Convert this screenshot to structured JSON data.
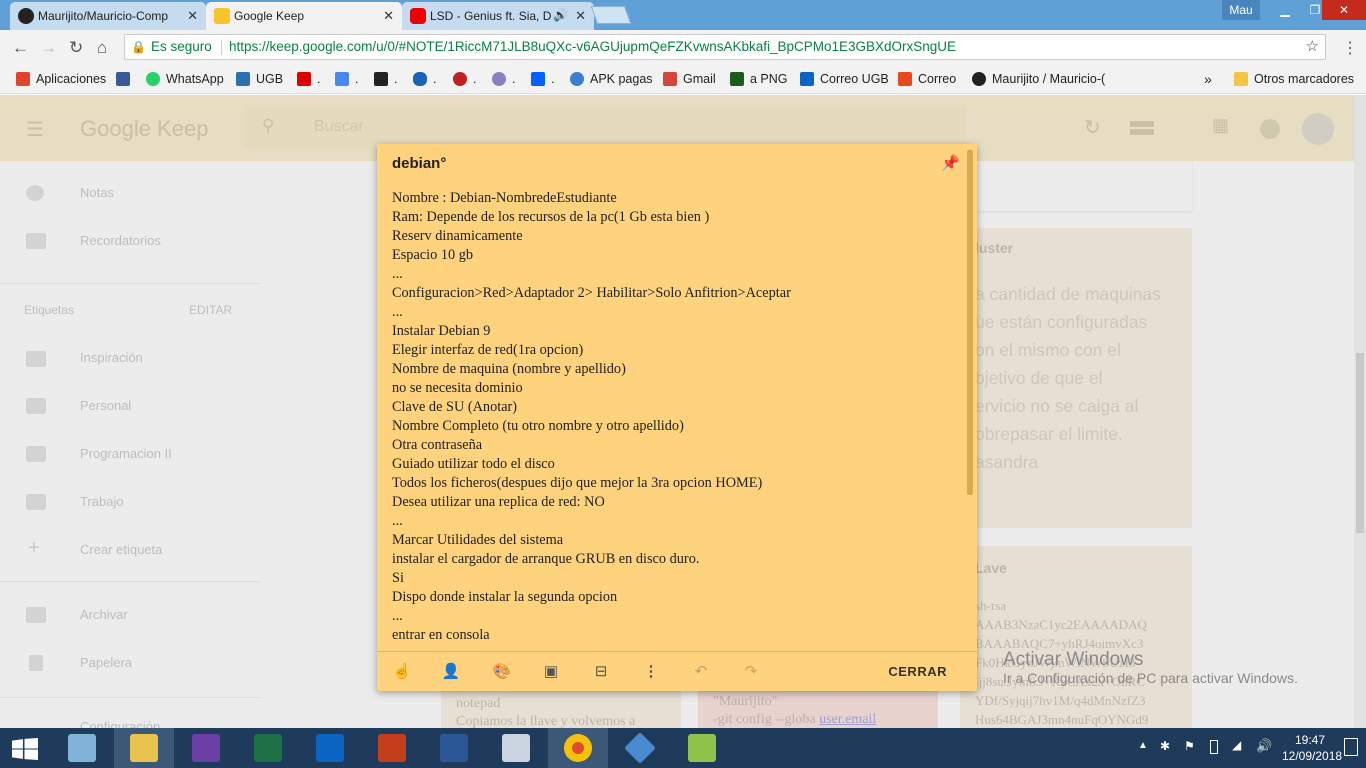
{
  "browser": {
    "tabs": [
      {
        "label": "Maurijito/Mauricio-Comp",
        "close": "✕"
      },
      {
        "label": "Google Keep",
        "close": "✕"
      },
      {
        "label": "LSD - Genius ft. Sia, D",
        "close": "✕"
      }
    ],
    "user": "Mau",
    "secure_label": "Es seguro",
    "url": "https://keep.google.com/u/0/#NOTE/1RiccM71JLB8uQXc-v6AGUjupmQeFZKvwnsAKbkafi_BpCPMo1E3GBXdOrxSngUE",
    "bookmarks": [
      {
        "label": "Aplicaciones",
        "icon": "apps-grid-icon",
        "color": "#e0452b"
      },
      {
        "label": "",
        "icon": "facebook-icon",
        "color": "#3b5998"
      },
      {
        "label": "WhatsApp",
        "icon": "whatsapp-icon",
        "color": "#25d366"
      },
      {
        "label": "UGB",
        "icon": "ugb-icon",
        "color": "#2c6fb3"
      },
      {
        "label": ".",
        "icon": "youtube-icon",
        "color": "#e00000"
      },
      {
        "label": ".",
        "icon": "translate-icon",
        "color": "#4a87f0"
      },
      {
        "label": ".",
        "icon": "x-icon",
        "color": "#222222"
      },
      {
        "label": ".",
        "icon": "cloud-icon",
        "color": "#1a62b8"
      },
      {
        "label": ".",
        "icon": "pokeball-icon",
        "color": "#c22020"
      },
      {
        "label": ".",
        "icon": "chrome-icon",
        "color": "#8c7fbf"
      },
      {
        "label": ".",
        "icon": "dropbox-icon",
        "color": "#0061fe"
      },
      {
        "label": "APK pagas",
        "icon": "apk-icon",
        "color": "#3a7fd0"
      },
      {
        "label": "Gmail",
        "icon": "gmail-icon",
        "color": "#d44638"
      },
      {
        "label": "a PNG",
        "icon": "png-icon",
        "color": "#1d5b1d"
      },
      {
        "label": "Correo UGB",
        "icon": "outlook-icon",
        "color": "#0a64c2"
      },
      {
        "label": "Correo",
        "icon": "office-icon",
        "color": "#e8491d"
      },
      {
        "label": "Maurijito / Mauricio-(",
        "icon": "github-icon",
        "color": "#222222"
      }
    ],
    "more": "»",
    "other_bookmarks": "Otros marcadores"
  },
  "keep": {
    "logo": "Google Keep",
    "search_placeholder": "Buscar",
    "sidebar": [
      {
        "label": "Notas",
        "icon": "bulb-icon"
      },
      {
        "label": "Recordatorios",
        "icon": "reminder-icon"
      }
    ],
    "labels_heading": "Etiquetas",
    "edit": "EDITAR",
    "labels": [
      "Inspiración",
      "Personal",
      "Programacion II",
      "Trabajo"
    ],
    "create_label": "Crear etiqueta",
    "archive": "Archivar",
    "trash": "Papelera",
    "settings": "Configuración"
  },
  "background_cards": {
    "cluster_title": "luster",
    "cluster_lines": [
      "a cantidad de maquinas",
      "ue están configuradas",
      "on el mismo con el",
      "bjetivo de que el",
      "ervicio no se caiga al",
      "obrepasar el limite.",
      "asandra"
    ],
    "llave_title": "Lave",
    "llave_lines": [
      "sh-rsa",
      "AAAB3NzaC1yc2EAAAADAQ",
      "BAAABAQC7+yhRJ4oimvXc3",
      "Fk0HkGynJWjmWlNWSUzI3",
      "ijj8su.Jym6.J+KyCAx2x+OnRC",
      "YDf/Syjqij7hv1M/q4dMnNzfZ3",
      "Hus64BGAJ3mn4nuFqOYNGd9"
    ],
    "card1_lines": [
      "notepad",
      "Copiamos la llave y volvemos a"
    ],
    "card2_lines": [
      "\"Maurijito\"",
      "-git config --globa"
    ],
    "card2_link": "user.email"
  },
  "note": {
    "title": "debian°",
    "lines": [
      "Nombre : Debian-NombredeEstudiante",
      "Ram: Depende de los recursos de la pc(1 Gb esta bien )",
      "Reserv dinamicamente",
      "Espacio 10 gb",
      "...",
      "Configuracion>Red>Adaptador 2> Habilitar>Solo Anfitrion>Aceptar",
      "...",
      "Instalar Debian 9",
      "Elegir interfaz de red(1ra opcion)",
      "Nombre de maquina (nombre y apellido)",
      "no se necesita dominio",
      "Clave de SU (Anotar)",
      "Nombre Completo (tu otro nombre y otro apellido)",
      "Otra contraseña",
      "Guiado utilizar todo el disco",
      "Todos los ficheros(despues dijo que mejor la 3ra opcion HOME)",
      "Desea utilizar una replica de red: NO",
      "...",
      "Marcar Utilidades del sistema",
      "instalar el cargador de arranque GRUB en disco duro.",
      "Si",
      "Dispo donde instalar la segunda opcion",
      "...",
      "entrar en consola"
    ],
    "close_label": "CERRAR",
    "color": "#ffd27d"
  },
  "watermark": {
    "line1": "Activar Windows",
    "line2": "Ir a Configuración de PC para activar Windows."
  },
  "taskbar": {
    "time": "19:47",
    "date": "12/09/2018"
  }
}
